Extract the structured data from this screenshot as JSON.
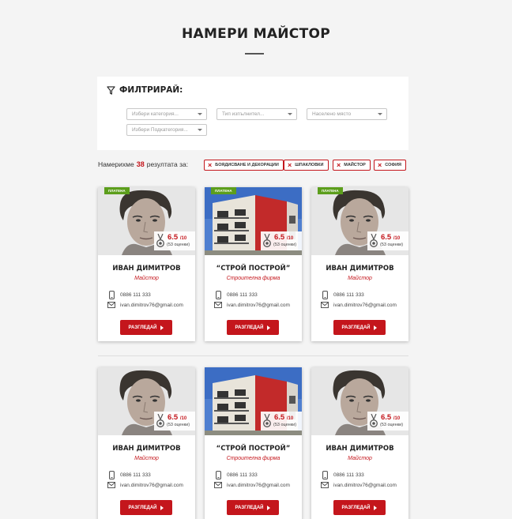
{
  "page": {
    "title": "НАМЕРИ МАЙСТОР"
  },
  "filter": {
    "title": "ФИЛТРИРАЙ:",
    "selects": [
      {
        "placeholder": "Избери категория..."
      },
      {
        "placeholder": "Тип изпълнител..."
      },
      {
        "placeholder": "Населено място"
      },
      {
        "placeholder": "Избери Подкатегория..."
      }
    ]
  },
  "results": {
    "prefix": "Намерихме",
    "count": "38",
    "suffix": "резултата за:"
  },
  "tags": [
    "БОЯДИСВАНЕ И ДЕКОРАЦИИ",
    "ШПАКЛОВКИ",
    "МАЙСТОР",
    "СОФИЯ"
  ],
  "cards": [
    {
      "badge": "ПЛАТЕНА",
      "photo": "portrait",
      "score": "6.5",
      "scale": "/10",
      "reviews": "(53 оценки)",
      "name": "ИВАН ДИМИТРОВ",
      "role": "Майстор",
      "phone": "0886 111 333",
      "email": "ivan.dimitrov76@gmail.com",
      "button": "РАЗГЛЕДАЙ"
    },
    {
      "badge": "ПЛАТЕНА",
      "photo": "building",
      "score": "6.5",
      "scale": "/10",
      "reviews": "(53 оценки)",
      "name": "“СТРОЙ ПОСТРОЙ”",
      "role": "Строителна фирма",
      "phone": "0886 111 333",
      "email": "ivan.dimitrov76@gmail.com",
      "button": "РАЗГЛЕДАЙ"
    },
    {
      "badge": "ПЛАТЕНА",
      "photo": "portrait",
      "score": "6.5",
      "scale": "/10",
      "reviews": "(53 оценки)",
      "name": "ИВАН ДИМИТРОВ",
      "role": "Майстор",
      "phone": "0886 111 333",
      "email": "ivan.dimitrov76@gmail.com",
      "button": "РАЗГЛЕДАЙ"
    },
    {
      "badge": "",
      "photo": "portrait",
      "score": "6.5",
      "scale": "/10",
      "reviews": "(53 оценки)",
      "name": "ИВАН ДИМИТРОВ",
      "role": "Майстор",
      "phone": "0886 111 333",
      "email": "ivan.dimitrov76@gmail.com",
      "button": "РАЗГЛЕДАЙ"
    },
    {
      "badge": "",
      "photo": "building",
      "score": "6.5",
      "scale": "/10",
      "reviews": "(53 оценки)",
      "name": "“СТРОЙ ПОСТРОЙ”",
      "role": "Строителна фирма",
      "phone": "0886 111 333",
      "email": "ivan.dimitrov76@gmail.com",
      "button": "РАЗГЛЕДАЙ"
    },
    {
      "badge": "",
      "photo": "portrait",
      "score": "6.5",
      "scale": "/10",
      "reviews": "(53 оценки)",
      "name": "ИВАН ДИМИТРОВ",
      "role": "Майстор",
      "phone": "0886 111 333",
      "email": "ivan.dimitrov76@gmail.com",
      "button": "РАЗГЛЕДАЙ"
    }
  ],
  "colors": {
    "accent": "#c4161c",
    "badge": "#5c9e1c",
    "background": "#f4f4f4"
  }
}
